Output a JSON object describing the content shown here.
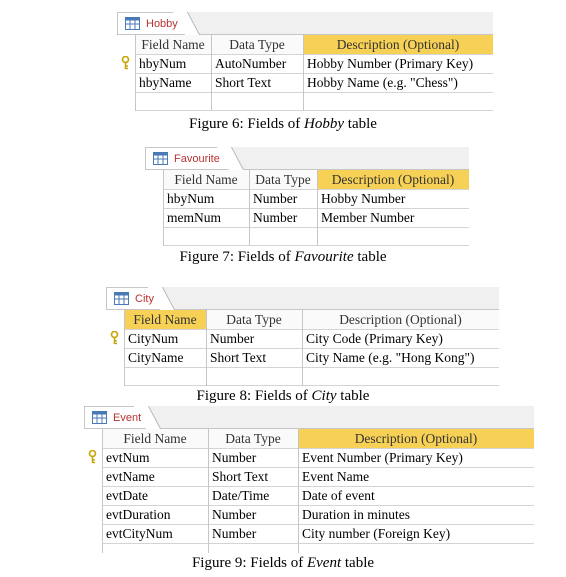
{
  "headers": {
    "field_name": "Field Name",
    "data_type": "Data Type",
    "description": "Description (Optional)"
  },
  "hobby": {
    "tab": "Hobby",
    "rows": [
      {
        "name": "hbyNum",
        "type": "AutoNumber",
        "desc": "Hobby Number (Primary Key)",
        "key": true
      },
      {
        "name": "hbyName",
        "type": "Short Text",
        "desc": "Hobby Name (e.g. \"Chess\")",
        "key": false
      }
    ],
    "caption": {
      "prefix": "Figure 6: Fields of ",
      "name": "Hobby",
      "suffix": " table"
    }
  },
  "favourite": {
    "tab": "Favourite",
    "rows": [
      {
        "name": "hbyNum",
        "type": "Number",
        "desc": "Hobby Number",
        "key": false
      },
      {
        "name": "memNum",
        "type": "Number",
        "desc": "Member Number",
        "key": false
      }
    ],
    "caption": {
      "prefix": "Figure 7: Fields of ",
      "name": "Favourite",
      "suffix": " table"
    }
  },
  "city": {
    "tab": "City",
    "rows": [
      {
        "name": "CityNum",
        "type": "Number",
        "desc": "City Code (Primary Key)",
        "key": true
      },
      {
        "name": "CityName",
        "type": "Short Text",
        "desc": "City Name (e.g. \"Hong Kong\")",
        "key": false
      }
    ],
    "caption": {
      "prefix": "Figure 8: Fields of ",
      "name": "City",
      "suffix": " table"
    }
  },
  "event": {
    "tab": "Event",
    "rows": [
      {
        "name": "evtNum",
        "type": "Number",
        "desc": "Event Number (Primary Key)",
        "key": true
      },
      {
        "name": "evtName",
        "type": "Short Text",
        "desc": "Event Name",
        "key": false
      },
      {
        "name": "evtDate",
        "type": "Date/Time",
        "desc": "Date of event",
        "key": false
      },
      {
        "name": "evtDuration",
        "type": "Number",
        "desc": "Duration in minutes",
        "key": false
      },
      {
        "name": "evtCityNum",
        "type": "Number",
        "desc": "City number (Foreign Key)",
        "key": false
      }
    ],
    "caption": {
      "prefix": "Figure 9: Fields of ",
      "name": "Event",
      "suffix": " table"
    }
  },
  "colors": {
    "highlight": "#f7d156",
    "tab_text": "#b83232",
    "key_icon": "#c9a400"
  },
  "icons": {
    "table": "table-icon",
    "key": "primary-key-icon"
  }
}
